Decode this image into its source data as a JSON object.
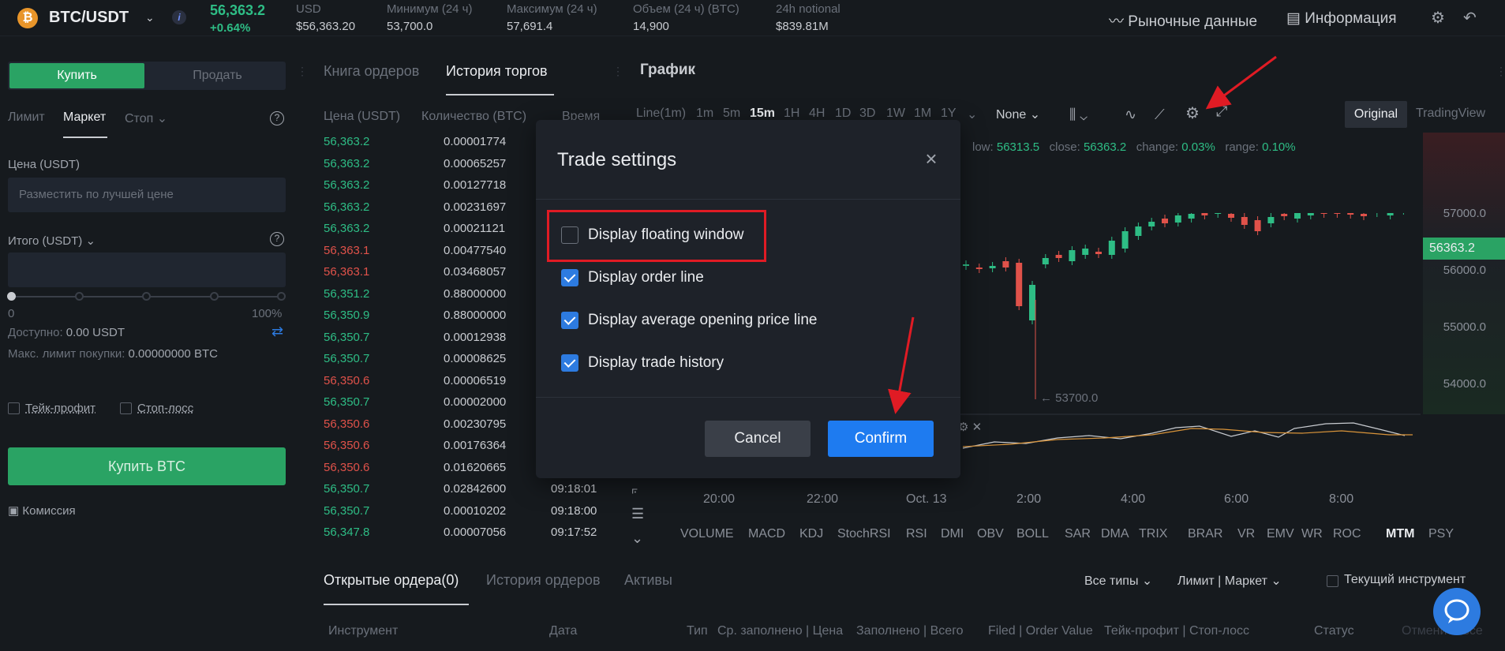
{
  "header": {
    "pair": "BTC/USDT",
    "last_price": "56,363.2",
    "change": "+0.64%",
    "stats": [
      {
        "label": "USD",
        "value": "$56,363.20"
      },
      {
        "label": "Минимум (24 ч)",
        "value": "53,700.0"
      },
      {
        "label": "Максимум (24 ч)",
        "value": "57,691.4"
      },
      {
        "label": "Объем (24 ч) (BTC)",
        "value": "14,900"
      },
      {
        "label": "24h notional",
        "value": "$839.81M"
      }
    ],
    "market_data": "Рыночные данные",
    "info": "Информация"
  },
  "order_form": {
    "buy_tab": "Купить",
    "sell_tab": "Продать",
    "order_types": [
      "Лимит",
      "Маркет",
      "Стоп"
    ],
    "price_label": "Цена (USDT)",
    "price_placeholder": "Разместить по лучшей цене",
    "total_label": "Итого (USDT)",
    "slider_min": "0",
    "slider_max": "100%",
    "available_label": "Доступно:",
    "available_value": "0.00 USDT",
    "max_buy_label": "Макс. лимит покупки:",
    "max_buy_value": "0.00000000 BTC",
    "take_profit": "Тейк-профит",
    "stop_loss": "Стоп-лосс",
    "buy_button": "Купить BTC",
    "commission": "Комиссия"
  },
  "trades_panel": {
    "tabs": [
      "Книга ордеров",
      "История торгов"
    ],
    "columns": [
      "Цена (USDT)",
      "Количество (BTC)",
      "Время"
    ],
    "rows": [
      {
        "price": "56,363.2",
        "qty": "0.00001774",
        "time": "",
        "side": "g"
      },
      {
        "price": "56,363.2",
        "qty": "0.00065257",
        "time": "",
        "side": "g"
      },
      {
        "price": "56,363.2",
        "qty": "0.00127718",
        "time": "",
        "side": "g"
      },
      {
        "price": "56,363.2",
        "qty": "0.00231697",
        "time": "",
        "side": "g"
      },
      {
        "price": "56,363.2",
        "qty": "0.00021121",
        "time": "",
        "side": "g"
      },
      {
        "price": "56,363.1",
        "qty": "0.00477540",
        "time": "",
        "side": "r"
      },
      {
        "price": "56,363.1",
        "qty": "0.03468057",
        "time": "",
        "side": "r"
      },
      {
        "price": "56,351.2",
        "qty": "0.88000000",
        "time": "",
        "side": "g"
      },
      {
        "price": "56,350.9",
        "qty": "0.88000000",
        "time": "",
        "side": "g"
      },
      {
        "price": "56,350.7",
        "qty": "0.00012938",
        "time": "",
        "side": "g"
      },
      {
        "price": "56,350.7",
        "qty": "0.00008625",
        "time": "",
        "side": "g"
      },
      {
        "price": "56,350.6",
        "qty": "0.00006519",
        "time": "",
        "side": "r"
      },
      {
        "price": "56,350.7",
        "qty": "0.00002000",
        "time": "",
        "side": "g"
      },
      {
        "price": "56,350.6",
        "qty": "0.00230795",
        "time": "",
        "side": "r"
      },
      {
        "price": "56,350.6",
        "qty": "0.00176364",
        "time": "",
        "side": "r"
      },
      {
        "price": "56,350.6",
        "qty": "0.01620665",
        "time": "",
        "side": "r"
      },
      {
        "price": "56,350.7",
        "qty": "0.02842600",
        "time": "09:18:01",
        "side": "g"
      },
      {
        "price": "56,350.7",
        "qty": "0.00010202",
        "time": "09:18:00",
        "side": "g"
      },
      {
        "price": "56,347.8",
        "qty": "0.00007056",
        "time": "09:17:52",
        "side": "g"
      }
    ]
  },
  "chart": {
    "title": "График",
    "timeframes": [
      "Line(1m)",
      "1m",
      "5m",
      "15m",
      "1H",
      "4H",
      "1D",
      "3D",
      "1W",
      "1M",
      "1Y"
    ],
    "active_tf": "15m",
    "indicator_select": "None",
    "view_original": "Original",
    "view_tv": "TradingView",
    "ohlc": {
      "low_label": "low:",
      "low": "56313.5",
      "close_label": "close:",
      "close": "56363.2",
      "change_label": "change:",
      "change": "0.03%",
      "range_label": "range:",
      "range": "0.10%"
    },
    "price_labels": [
      "57000.0",
      "56000.0",
      "55000.0",
      "54000.0"
    ],
    "current_price": "56363.2",
    "low_marker": "← 53700.0",
    "time_labels": [
      "20:00",
      "22:00",
      "Oct. 13",
      "2:00",
      "4:00",
      "6:00",
      "8:00"
    ],
    "indicators": [
      "VOLUME",
      "MACD",
      "KDJ",
      "StochRSI",
      "RSI",
      "DMI",
      "OBV",
      "BOLL",
      "SAR",
      "DMA",
      "TRIX",
      "BRAR",
      "VR",
      "EMV",
      "WR",
      "ROC",
      "MTM",
      "PSY"
    ],
    "active_indicator": "MTM"
  },
  "bottom": {
    "tabs": [
      "Открытые ордера(0)",
      "История ордеров",
      "Активы"
    ],
    "filter_types": "Все типы",
    "filter_limit": "Лимит | Маркет",
    "current_instrument": "Текущий инструмент",
    "columns": [
      "Инструмент",
      "Дата",
      "Тип",
      "Ср. заполнено | Цена",
      "Заполнено | Всего",
      "Filed | Order Value",
      "Тейк-профит | Стоп-лосс",
      "Статус",
      "Отменить все"
    ]
  },
  "modal": {
    "title": "Trade settings",
    "options": [
      {
        "label": "Display floating window",
        "checked": false
      },
      {
        "label": "Display order line",
        "checked": true
      },
      {
        "label": "Display average opening price line",
        "checked": true
      },
      {
        "label": "Display trade history",
        "checked": true
      }
    ],
    "cancel": "Cancel",
    "confirm": "Confirm"
  },
  "colors": {
    "up": "#2ebd85",
    "down": "#e0524a",
    "accent": "#1e7bf0",
    "buy": "#2aa364",
    "annotation": "#e01b24"
  }
}
